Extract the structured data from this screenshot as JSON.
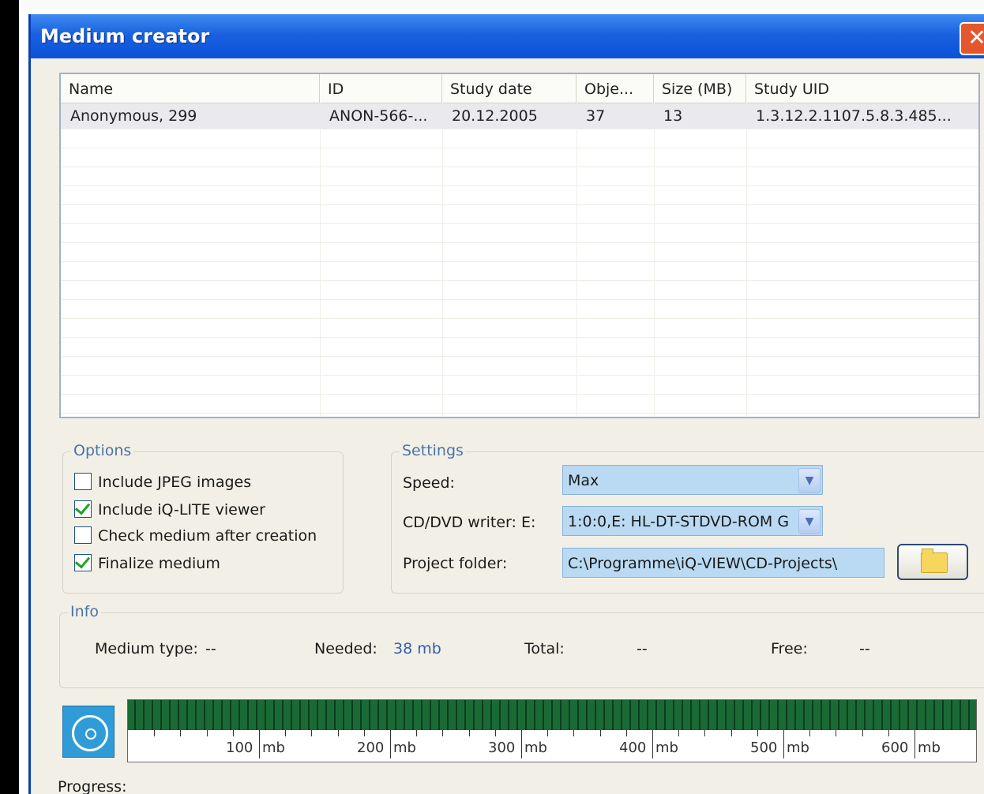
{
  "window": {
    "title": "Medium creator"
  },
  "list": {
    "columns": [
      {
        "label": "Name"
      },
      {
        "label": "ID"
      },
      {
        "label": "Study date"
      },
      {
        "label": "Obje..."
      },
      {
        "label": "Size (MB)"
      },
      {
        "label": "Study UID"
      }
    ],
    "rows": [
      {
        "name": "Anonymous, 299",
        "id": "ANON-566-...",
        "study_date": "20.12.2005",
        "objects": "37",
        "size": "13",
        "study_uid": "1.3.12.2.1107.5.8.3.485..."
      }
    ]
  },
  "options": {
    "label": "Options",
    "items": [
      {
        "label": "Include JPEG images",
        "checked": false
      },
      {
        "label": "Include iQ-LITE viewer",
        "checked": true
      },
      {
        "label": "Check medium after creation",
        "checked": false
      },
      {
        "label": "Finalize medium",
        "checked": true
      }
    ]
  },
  "settings": {
    "label": "Settings",
    "speed_label": "Speed:",
    "speed_value": "Max",
    "writer_label": "CD/DVD writer:  E:",
    "writer_value": "1:0:0,E: HL-DT-STDVD-ROM G",
    "folder_label": "Project folder:",
    "folder_value": "C:\\Programme\\iQ-VIEW\\CD-Projects\\"
  },
  "info": {
    "label": "Info",
    "medium_type_label": "Medium type:",
    "medium_type_value": "--",
    "needed_label": "Needed:",
    "needed_value": "38 mb",
    "total_label": "Total:",
    "total_value": "--",
    "free_label": "Free:",
    "free_value": "--"
  },
  "capacity": {
    "used_fraction": 1.0,
    "fill_color": "#1a6a36",
    "scale": [
      "100",
      "200",
      "300",
      "400",
      "500",
      "600"
    ],
    "unit": "mb"
  },
  "progress": {
    "label": "Progress:"
  }
}
